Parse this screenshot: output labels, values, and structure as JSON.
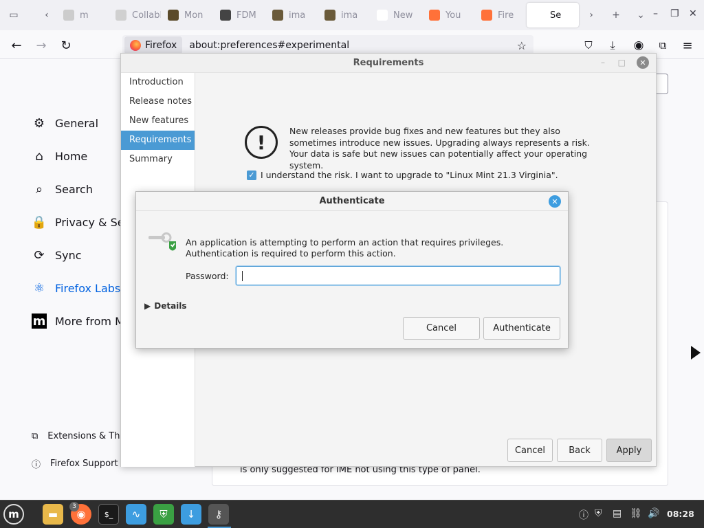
{
  "browser": {
    "tabs": [
      {
        "label": "m",
        "color": "#cccccc"
      },
      {
        "label": "CollabN",
        "color": "#d0d0d0"
      },
      {
        "label": "Mon",
        "color": "#5a4a2a"
      },
      {
        "label": "FDM",
        "color": "#444444"
      },
      {
        "label": "ima",
        "color": "#6a5a3a"
      },
      {
        "label": "ima",
        "color": "#6a5a3a"
      },
      {
        "label": "New",
        "color": "#ffffff"
      },
      {
        "label": "You",
        "color": "#ff7139"
      },
      {
        "label": "Fire",
        "color": "#ff7139"
      },
      {
        "label": "Se",
        "color": "#ffffff",
        "active": true
      }
    ],
    "identity_label": "Firefox",
    "url": "about:preferences#experimental"
  },
  "settings": {
    "categories": [
      {
        "label": "General",
        "icon": "gear-icon"
      },
      {
        "label": "Home",
        "icon": "home-icon"
      },
      {
        "label": "Search",
        "icon": "search-icon"
      },
      {
        "label": "Privacy & Sec",
        "icon": "lock-icon"
      },
      {
        "label": "Sync",
        "icon": "sync-icon"
      },
      {
        "label": "Firefox Labs",
        "icon": "labs-icon",
        "selected": true
      },
      {
        "label": "More from M",
        "icon": "mozilla-icon"
      }
    ],
    "footer_links": [
      {
        "label": "Extensions & Th",
        "icon": "puzzle-icon"
      },
      {
        "label": "Firefox Support",
        "icon": "help-icon"
      }
    ],
    "card_text": "is only suggested for IME not using this type of panel."
  },
  "upgrade_dialog": {
    "title": "Requirements",
    "steps": [
      {
        "label": "Introduction"
      },
      {
        "label": "Release notes"
      },
      {
        "label": "New features"
      },
      {
        "label": "Requirements",
        "active": true
      },
      {
        "label": "Summary"
      }
    ],
    "warning": "New releases provide bug fixes and new features but they also sometimes introduce new issues. Upgrading always represents a risk. Your data is safe but new issues can potentially affect your operating system.",
    "risk_label": "I understand the risk. I want to upgrade to \"Linux Mint 21.3 Virginia\".",
    "risk_checked": true,
    "buttons": {
      "cancel": "Cancel",
      "back": "Back",
      "apply": "Apply"
    }
  },
  "auth_dialog": {
    "title": "Authenticate",
    "message": "An application is attempting to perform an action that requires privileges. Authentication is required to perform this action.",
    "password_label": "Password:",
    "password_value": "",
    "details_label": "Details",
    "cancel_label": "Cancel",
    "authenticate_label": "Authenticate"
  },
  "taskbar": {
    "badge_count": "3",
    "clock": "08:28"
  }
}
